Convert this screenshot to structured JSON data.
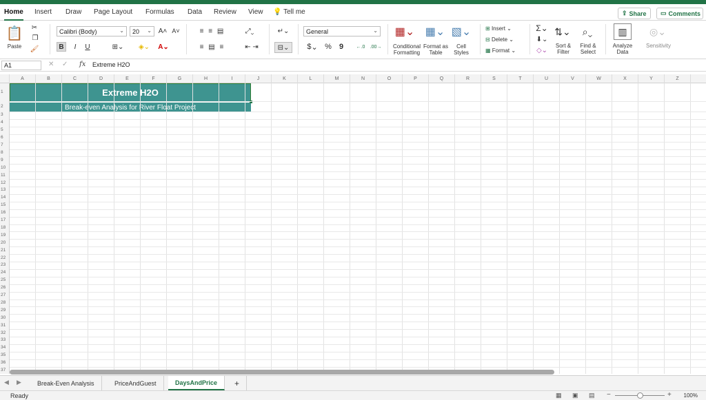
{
  "ribbon_tabs": [
    "Home",
    "Insert",
    "Draw",
    "Page Layout",
    "Formulas",
    "Data",
    "Review",
    "View"
  ],
  "active_tab": "Home",
  "tell_me": "Tell me",
  "share_label": "Share",
  "comments_label": "Comments",
  "clipboard": {
    "paste": "Paste"
  },
  "font": {
    "name": "Calibri (Body)",
    "size": "20",
    "bold": "B",
    "italic": "I",
    "underline": "U"
  },
  "number_format": "General",
  "number_buttons": {
    "currency": "$",
    "percent": "%",
    "comma": "9"
  },
  "styles": {
    "conditional": "Conditional Formatting",
    "format_table": "Format as Table",
    "cell_styles": "Cell Styles"
  },
  "cells_group": {
    "insert": "Insert",
    "delete": "Delete",
    "format": "Format"
  },
  "editing": {
    "sort": "Sort & Filter",
    "find": "Find & Select"
  },
  "analyze": "Analyze Data",
  "sensitivity": "Sensitivity",
  "formula_bar": {
    "name_box": "A1",
    "fx": "fx",
    "content": "Extreme H2O"
  },
  "columns": [
    "A",
    "B",
    "C",
    "D",
    "E",
    "F",
    "G",
    "H",
    "I",
    "J",
    "K",
    "L",
    "M",
    "N",
    "O",
    "P",
    "Q",
    "R",
    "S",
    "T",
    "U",
    "V",
    "W",
    "X",
    "Y",
    "Z"
  ],
  "rows": [
    "1",
    "2",
    "3",
    "4",
    "5",
    "6",
    "7",
    "8",
    "9",
    "10",
    "11",
    "12",
    "13",
    "14",
    "15",
    "16",
    "17",
    "18",
    "19",
    "20",
    "21",
    "22",
    "23",
    "24",
    "25",
    "26",
    "27",
    "28",
    "29",
    "30",
    "31",
    "32",
    "33",
    "34",
    "35",
    "36",
    "37"
  ],
  "cells": {
    "title": "Extreme H2O",
    "subtitle": "Break-even Analysis for River Float Project"
  },
  "sheets": [
    "Break-Even Analysis",
    "PriceAndGuest",
    "DaysAndPrice"
  ],
  "active_sheet": "DaysAndPrice",
  "add_sheet": "+",
  "status": "Ready",
  "zoom": "100%",
  "colors": {
    "accent": "#217346",
    "header_fill": "#3e9490"
  }
}
